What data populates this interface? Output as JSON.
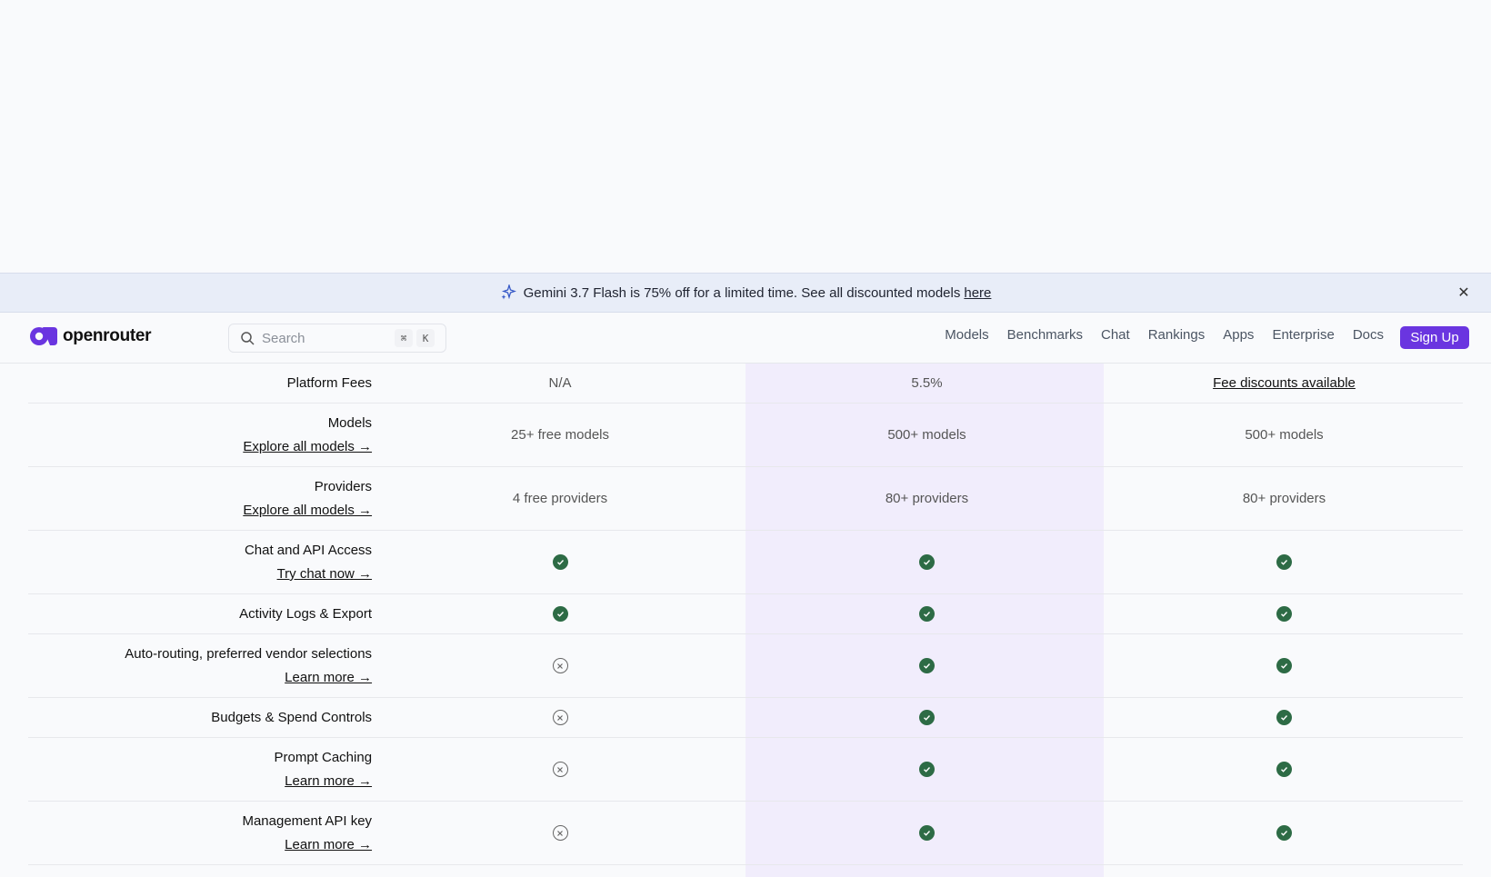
{
  "banner": {
    "text": "Gemini 3.7 Flash is 75% off for a limited time. See all discounted models",
    "link": "here",
    "icon": "sparkle-icon",
    "close_icon": "close-icon"
  },
  "nav": {
    "logo_text": "openrouter",
    "search_placeholder": "Search",
    "kbd_cmd": "⌘",
    "kbd_key": "K",
    "links": [
      "Models",
      "Benchmarks",
      "Chat",
      "Rankings",
      "Apps",
      "Enterprise",
      "Docs"
    ],
    "signup": "Sign Up",
    "accent": "#6a35e0"
  },
  "table": {
    "rows": [
      {
        "label": "Platform Fees",
        "link": "",
        "free": "N/A",
        "payg": "5.5%",
        "enterprise": "Fee discounts available"
      },
      {
        "label": "Models",
        "link": "Explore all models →",
        "free": "25+ free models",
        "payg": "500+ models",
        "enterprise": "500+ models"
      },
      {
        "label": "Providers",
        "link": "Explore all models →",
        "free": "4 free providers",
        "payg": "80+ providers",
        "enterprise": "80+ providers"
      },
      {
        "label": "Chat and API Access",
        "link": "Try chat now →",
        "free": "check",
        "payg": "check",
        "enterprise": "check"
      },
      {
        "label": "Activity Logs & Export",
        "link": "",
        "free": "check",
        "payg": "check",
        "enterprise": "check"
      },
      {
        "label": "Auto-routing, preferred vendor selections",
        "link": "Learn more →",
        "free": "x",
        "payg": "check",
        "enterprise": "check"
      },
      {
        "label": "Budgets & Spend Controls",
        "link": "",
        "free": "x",
        "payg": "check",
        "enterprise": "check"
      },
      {
        "label": "Prompt Caching",
        "link": "Learn more →",
        "free": "x",
        "payg": "check",
        "enterprise": "check"
      },
      {
        "label": "Management API key",
        "link": "Learn more →",
        "free": "x",
        "payg": "check",
        "enterprise": "check"
      }
    ],
    "check_color": "#2d6b45",
    "highlight_color": "#f1edfc"
  }
}
